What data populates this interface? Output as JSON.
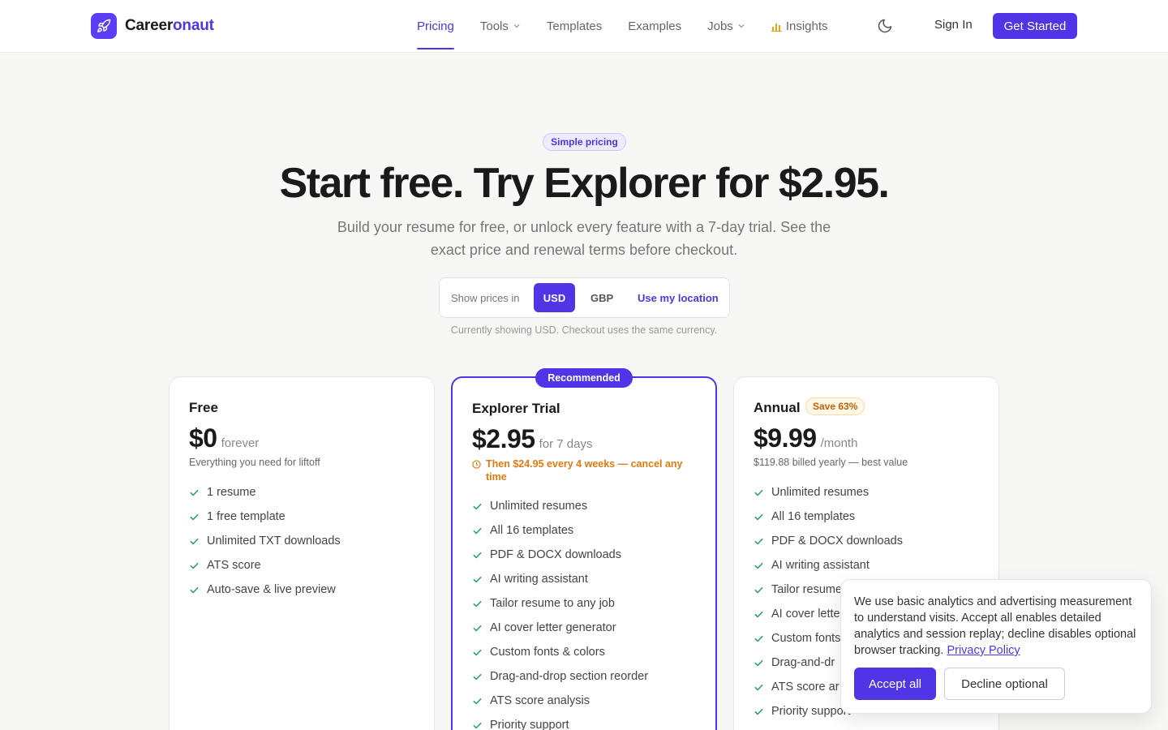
{
  "brand": {
    "name_part1": "Career",
    "name_part2": "onaut",
    "logo_icon": "rocket-icon",
    "accent_color": "#4f35e6"
  },
  "nav": {
    "items": [
      {
        "label": "Pricing",
        "active": true
      },
      {
        "label": "Tools",
        "has_dropdown": true
      },
      {
        "label": "Templates"
      },
      {
        "label": "Examples"
      },
      {
        "label": "Jobs",
        "has_dropdown": true
      },
      {
        "label": "Insights",
        "icon": "bar-chart-icon"
      }
    ],
    "theme_toggle_icon": "moon-icon",
    "sign_in": "Sign In",
    "get_started": "Get Started"
  },
  "hero": {
    "badge": "Simple pricing",
    "title": "Start free. Try Explorer for $2.95.",
    "subtitle": "Build your resume for free, or unlock every feature with a 7-day trial. See the exact price and renewal terms before checkout."
  },
  "currency": {
    "label": "Show prices in",
    "options": [
      "USD",
      "GBP"
    ],
    "selected": "USD",
    "use_location": "Use my location",
    "note": "Currently showing USD. Checkout uses the same currency."
  },
  "plans": [
    {
      "name": "Free",
      "price": "$0",
      "period": "forever",
      "note": "Everything you need for liftoff",
      "features": [
        "1 resume",
        "1 free template",
        "Unlimited TXT downloads",
        "ATS score",
        "Auto-save & live preview"
      ]
    },
    {
      "name": "Explorer Trial",
      "badge": "Recommended",
      "price": "$2.95",
      "period": "for 7 days",
      "note": "Then $24.95 every 4 weeks — cancel any time",
      "features": [
        "Unlimited resumes",
        "All 16 templates",
        "PDF & DOCX downloads",
        "AI writing assistant",
        "Tailor resume to any job",
        "AI cover letter generator",
        "Custom fonts & colors",
        "Drag-and-drop section reorder",
        "ATS score analysis",
        "Priority support"
      ]
    },
    {
      "name": "Annual",
      "badge": "Save 63%",
      "price": "$9.99",
      "period": "/month",
      "note": "$119.88 billed yearly — best value",
      "features": [
        "Unlimited resumes",
        "All 16 templates",
        "PDF & DOCX downloads",
        "AI writing assistant",
        "Tailor resume",
        "AI cover lette",
        "Custom fonts",
        "Drag-and-dr",
        "ATS score ar",
        "Priority support"
      ]
    }
  ],
  "cookie": {
    "text": "We use basic analytics and advertising measurement to understand visits. Accept all enables detailed analytics and session replay; decline disables optional browser tracking.",
    "link": "Privacy Policy",
    "accept": "Accept all",
    "decline": "Decline optional"
  }
}
